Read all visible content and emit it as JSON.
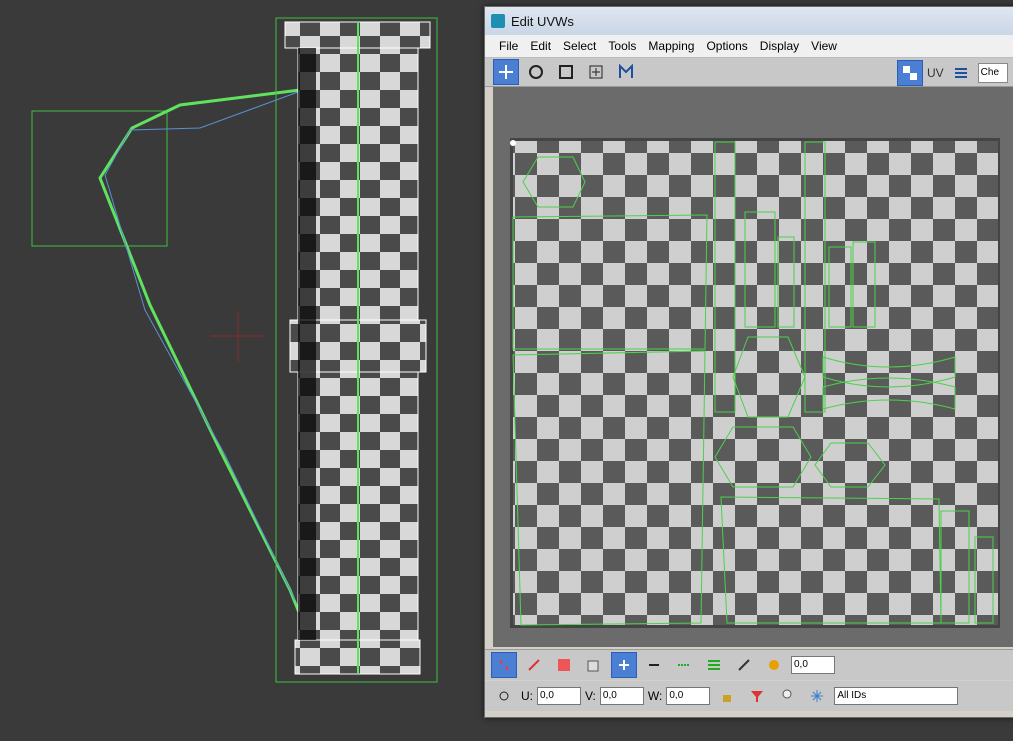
{
  "window": {
    "title": "Edit UVWs"
  },
  "menu": [
    "File",
    "Edit",
    "Select",
    "Tools",
    "Mapping",
    "Options",
    "Display",
    "View"
  ],
  "toolbar": {
    "uv_label": "UV",
    "texture_dropdown": "Che"
  },
  "bottom": {
    "spinner_value": "0,0",
    "u_label": "U:",
    "u_value": "0,0",
    "v_label": "V:",
    "v_value": "0,0",
    "w_label": "W:",
    "w_value": "0,0",
    "ids_select": "All IDs"
  },
  "colors": {
    "accent_green": "#4bd14b",
    "selected_blue": "#4a7fd3",
    "checker_dark": "#5a5a5a",
    "checker_light": "#cfcfcf"
  }
}
